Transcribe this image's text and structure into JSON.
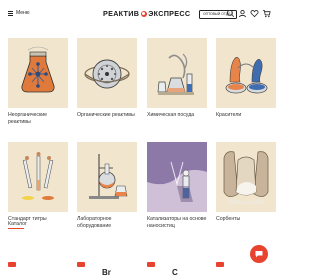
{
  "header": {
    "menu_label": "Меню",
    "logo_left": "РЕАКТИВ",
    "logo_right": "ЭКСПРЕСС",
    "wholesale_label": "ОПТОВЫЙ ОТДЕЛ",
    "icons": [
      "search-icon",
      "user-icon",
      "heart-icon",
      "cart-icon"
    ]
  },
  "categories": [
    {
      "label": "Неорганические реактивы"
    },
    {
      "label": "Органические реактивы"
    },
    {
      "label": "Химическая посуда"
    },
    {
      "label": "Красители"
    },
    {
      "label": "Стандарт титры"
    },
    {
      "label": "Лабораторное оборудование"
    },
    {
      "label": "Катализаторы на основе наносистиц"
    },
    {
      "label": "Сорбенты"
    }
  ],
  "catalog_link": "Каталог",
  "bottom": {
    "partial_text_1": "Br",
    "partial_text_2": "C"
  },
  "colors": {
    "accent": "#e8432f",
    "card_bg": "#f1e5cd",
    "text": "#222222"
  }
}
